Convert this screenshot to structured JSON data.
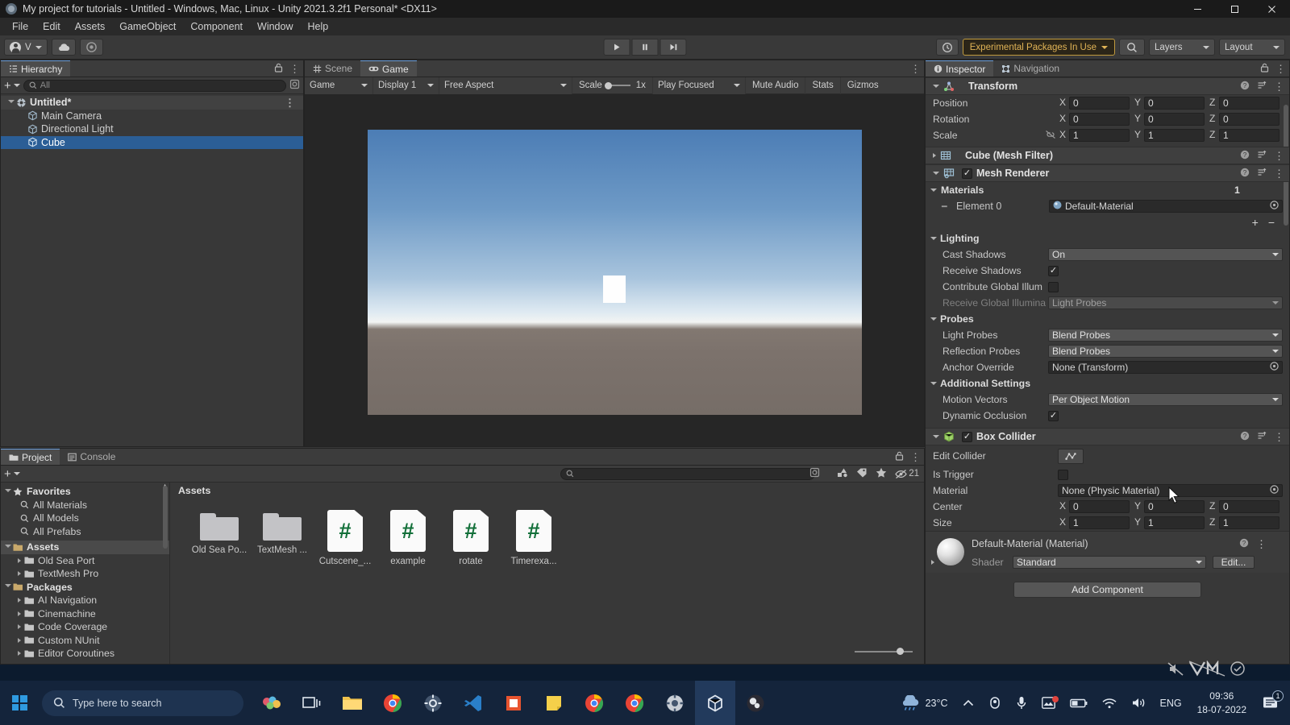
{
  "window": {
    "title": "My project for tutorials - Untitled - Windows, Mac, Linux - Unity 2021.3.2f1 Personal* <DX11>",
    "minimize": "–",
    "maximize": "❐",
    "close": "✕"
  },
  "menu": {
    "items": [
      "File",
      "Edit",
      "Assets",
      "GameObject",
      "Component",
      "Window",
      "Help"
    ]
  },
  "toolbar": {
    "account_label": "V",
    "cloud_label": "cloud-icon",
    "collab_label": "collab-icon",
    "play": "▶",
    "pause": "‖",
    "step": "▶|",
    "history_label": "undo-history-icon",
    "experimental_badge": "Experimental Packages In Use",
    "search_label": "search-icon",
    "layers": "Layers",
    "layout": "Layout"
  },
  "hierarchy": {
    "tab": "Hierarchy",
    "lock_icon": "lock-icon",
    "menu_icon": "kebab-icon",
    "add_label": "+",
    "search_placeholder": "All",
    "tree": [
      {
        "label": "Untitled*",
        "icon": "scene-icon",
        "depth": 0,
        "expanded": true,
        "selected": false,
        "root": true
      },
      {
        "label": "Main Camera",
        "icon": "gameobject-icon",
        "depth": 1,
        "expanded": false,
        "selected": false,
        "root": false
      },
      {
        "label": "Directional Light",
        "icon": "gameobject-icon",
        "depth": 1,
        "expanded": false,
        "selected": false,
        "root": false
      },
      {
        "label": "Cube",
        "icon": "gameobject-icon",
        "depth": 1,
        "expanded": false,
        "selected": true,
        "root": false
      }
    ]
  },
  "gameview": {
    "tabs": [
      {
        "label": "Scene",
        "icon": "scene-grid-icon",
        "active": false
      },
      {
        "label": "Game",
        "icon": "game-pad-icon",
        "active": true
      }
    ],
    "menu_icon": "kebab-icon",
    "controls": {
      "target": "Game",
      "display": "Display 1",
      "aspect": "Free Aspect",
      "scale_label": "Scale",
      "scale_value": "1x",
      "play_focused": "Play Focused",
      "mute_audio": "Mute Audio",
      "stats": "Stats",
      "gizmos": "Gizmos"
    }
  },
  "inspector": {
    "tabs": [
      {
        "label": "Inspector",
        "icon": "info-icon",
        "active": true
      },
      {
        "label": "Navigation",
        "icon": "navigation-icon",
        "active": false
      }
    ],
    "lock_icon": "lock-icon",
    "menu_icon": "kebab-icon",
    "components": [
      {
        "name": "Transform",
        "icon": "transform-icon",
        "rows": [
          {
            "label": "Position",
            "axes": [
              {
                "a": "X",
                "v": "0"
              },
              {
                "a": "Y",
                "v": "0"
              },
              {
                "a": "Z",
                "v": "0"
              }
            ]
          },
          {
            "label": "Rotation",
            "axes": [
              {
                "a": "X",
                "v": "0"
              },
              {
                "a": "Y",
                "v": "0"
              },
              {
                "a": "Z",
                "v": "0"
              }
            ]
          },
          {
            "label": "Scale",
            "link_icon": "constrain-proportions-off-icon",
            "axes": [
              {
                "a": "X",
                "v": "1"
              },
              {
                "a": "Y",
                "v": "1"
              },
              {
                "a": "Z",
                "v": "1"
              }
            ]
          }
        ]
      },
      {
        "name": "Cube (Mesh Filter)",
        "icon": "mesh-filter-icon",
        "collapsed": true
      },
      {
        "name": "Mesh Renderer",
        "icon": "mesh-renderer-icon",
        "checked": true
      }
    ],
    "materials": {
      "header": "Materials",
      "count": "1",
      "element_label": "Element 0",
      "element_value": "Default-Material",
      "add": "+",
      "remove": "−"
    },
    "lighting": {
      "header": "Lighting",
      "cast_shadows_label": "Cast Shadows",
      "cast_shadows_value": "On",
      "receive_shadows_label": "Receive Shadows",
      "receive_shadows_checked": true,
      "contribute_gi_label": "Contribute Global Illum",
      "contribute_gi_checked": false,
      "receive_gi_label": "Receive Global Illumina",
      "receive_gi_value": "Light Probes"
    },
    "probes": {
      "header": "Probes",
      "light_probes_label": "Light Probes",
      "light_probes_value": "Blend Probes",
      "reflection_probes_label": "Reflection Probes",
      "reflection_probes_value": "Blend Probes",
      "anchor_label": "Anchor Override",
      "anchor_value": "None (Transform)"
    },
    "additional": {
      "header": "Additional Settings",
      "motion_vectors_label": "Motion Vectors",
      "motion_vectors_value": "Per Object Motion",
      "dynamic_occlusion_label": "Dynamic Occlusion",
      "dynamic_occlusion_checked": true
    },
    "box_collider": {
      "name": "Box Collider",
      "icon": "box-collider-icon",
      "checked": true,
      "edit_collider_label": "Edit Collider",
      "edit_collider_icon": "edit-collider-icon",
      "is_trigger_label": "Is Trigger",
      "is_trigger_checked": false,
      "material_label": "Material",
      "material_value": "None (Physic Material)",
      "center_label": "Center",
      "center": [
        {
          "a": "X",
          "v": "0"
        },
        {
          "a": "Y",
          "v": "0"
        },
        {
          "a": "Z",
          "v": "0"
        }
      ],
      "size_label": "Size",
      "size": [
        {
          "a": "X",
          "v": "1"
        },
        {
          "a": "Y",
          "v": "1"
        },
        {
          "a": "Z",
          "v": "1"
        }
      ]
    },
    "material_preview": {
      "title": "Default-Material (Material)",
      "shader_label": "Shader",
      "shader_value": "Standard",
      "edit_label": "Edit..."
    },
    "add_component": "Add Component"
  },
  "project": {
    "tabs": [
      {
        "label": "Project",
        "icon": "folder-icon",
        "active": true
      },
      {
        "label": "Console",
        "icon": "console-icon",
        "active": false
      }
    ],
    "lock_icon": "lock-icon",
    "add_label": "+",
    "search_placeholder": "",
    "icons": [
      "filter-by-type-icon",
      "filter-by-label-icon",
      "favorite-icon",
      "hidden-packages-icon"
    ],
    "hidden_count": "21",
    "tree": [
      {
        "label": "Favorites",
        "depth": 0,
        "icon": "star-icon",
        "expanded": true,
        "bold": true
      },
      {
        "label": "All Materials",
        "depth": 1,
        "icon": "search-icon"
      },
      {
        "label": "All Models",
        "depth": 1,
        "icon": "search-icon"
      },
      {
        "label": "All Prefabs",
        "depth": 1,
        "icon": "search-icon"
      },
      {
        "label": "Assets",
        "depth": 0,
        "icon": "folder-open-icon",
        "expanded": true,
        "bold": true,
        "selected": true
      },
      {
        "label": "Old Sea Port",
        "depth": 1,
        "icon": "folder-icon",
        "collapsed": true
      },
      {
        "label": "TextMesh Pro",
        "depth": 1,
        "icon": "folder-icon",
        "collapsed": true
      },
      {
        "label": "Packages",
        "depth": 0,
        "icon": "folder-open-icon",
        "expanded": true,
        "bold": true
      },
      {
        "label": "AI Navigation",
        "depth": 1,
        "icon": "folder-icon",
        "collapsed": true
      },
      {
        "label": "Cinemachine",
        "depth": 1,
        "icon": "folder-icon",
        "collapsed": true
      },
      {
        "label": "Code Coverage",
        "depth": 1,
        "icon": "folder-icon",
        "collapsed": true
      },
      {
        "label": "Custom NUnit",
        "depth": 1,
        "icon": "folder-icon",
        "collapsed": true
      },
      {
        "label": "Editor Coroutines",
        "depth": 1,
        "icon": "folder-icon",
        "collapsed": true
      }
    ],
    "content_header": "Assets",
    "assets": [
      {
        "label": "Old Sea Po...",
        "type": "folder"
      },
      {
        "label": "TextMesh ...",
        "type": "folder"
      },
      {
        "label": "Cutscene_...",
        "type": "csharp"
      },
      {
        "label": "example",
        "type": "csharp"
      },
      {
        "label": "rotate",
        "type": "csharp"
      },
      {
        "label": "Timerexa...",
        "type": "csharp"
      }
    ]
  },
  "taskbar": {
    "search_placeholder": "Type here to search",
    "apps": [
      "paint-3d-icon",
      "task-view-icon",
      "file-explorer-icon",
      "chrome-icon",
      "settings-gear-icon",
      "vs-code-icon",
      "vlc-icon",
      "sticky-notes-icon",
      "chrome-canary-icon",
      "chrome-2-icon",
      "gear-2-icon",
      "unity-icon",
      "obs-icon"
    ],
    "weather_temp": "23°C",
    "language": "ENG",
    "time": "09:36",
    "date": "18-07-2022",
    "notification_count": "1"
  }
}
